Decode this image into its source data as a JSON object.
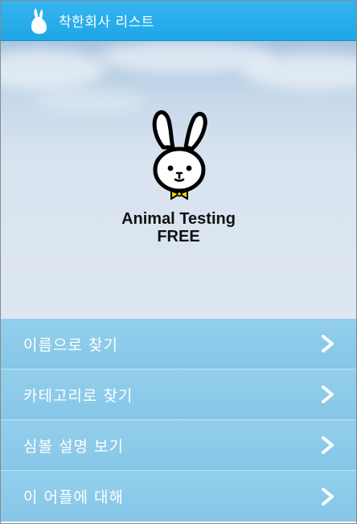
{
  "header": {
    "title": "착한회사 리스트",
    "icon": "rabbit-icon",
    "background_color": "#29aeea"
  },
  "hero": {
    "logo": "rabbit-logo-icon",
    "logo_text_line1": "Animal Testing",
    "logo_text_line2": "FREE"
  },
  "menu": {
    "background_color": "#8fcbe9",
    "items": [
      {
        "label": "이름으로 찾기",
        "icon": "chevron-right-icon"
      },
      {
        "label": "카테고리로 찾기",
        "icon": "chevron-right-icon"
      },
      {
        "label": "심볼 설명 보기",
        "icon": "chevron-right-icon"
      },
      {
        "label": "이 어플에 대해",
        "icon": "chevron-right-icon"
      }
    ]
  }
}
